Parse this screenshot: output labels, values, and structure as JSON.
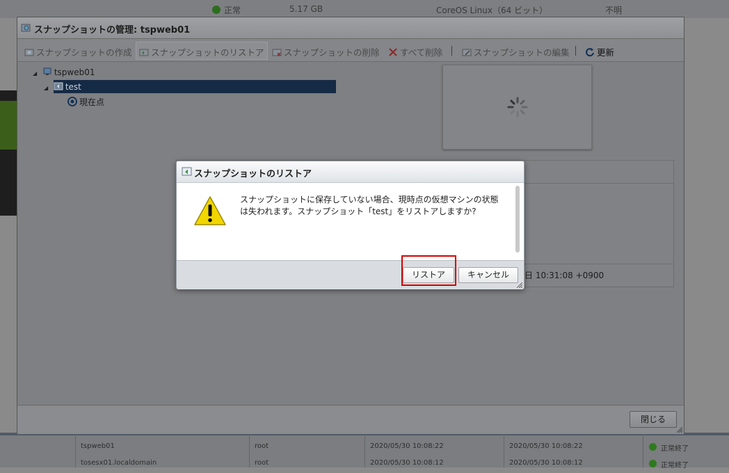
{
  "background": {
    "top_row": {
      "status": "正常",
      "memory": "5.17 GB",
      "os": "CoreOS Linux（64 ビット）",
      "state": "不明"
    },
    "bottom_rows": [
      {
        "name": "tspweb01",
        "user": "root",
        "started": "2020/05/30 10:08:22",
        "completed": "2020/05/30 10:08:22",
        "result": "正常終了"
      },
      {
        "name": "tosesx01.localdomain",
        "user": "root",
        "started": "2020/05/30 10:08:12",
        "completed": "2020/05/30 10:08:12",
        "result": "正常終了"
      }
    ]
  },
  "window": {
    "title": "スナップショットの管理: tspweb01",
    "toolbar": {
      "take": "スナップショットの作成",
      "restore": "スナップショットのリストア",
      "delete": "スナップショットの削除",
      "delete_all": "すべて削除",
      "edit": "スナップショットの編集",
      "refresh": "更新"
    },
    "tree": {
      "vm": "tspweb01",
      "snapshot": "test",
      "current": "現在点"
    },
    "details": {
      "date": "日 10:31:08 +0900"
    },
    "close_label": "閉じる"
  },
  "dialog": {
    "title": "スナップショットのリストア",
    "message_line1": "スナップショットに保存していない場合、現時点の仮想マシンの状態",
    "message_line2": "は失われます。スナップショット「test」をリストアしますか?",
    "restore_label": "リストア",
    "cancel_label": "キャンセル"
  },
  "colors": {
    "selection": "#152a44",
    "highlight": "#d60000",
    "warning": "#f2d600"
  }
}
